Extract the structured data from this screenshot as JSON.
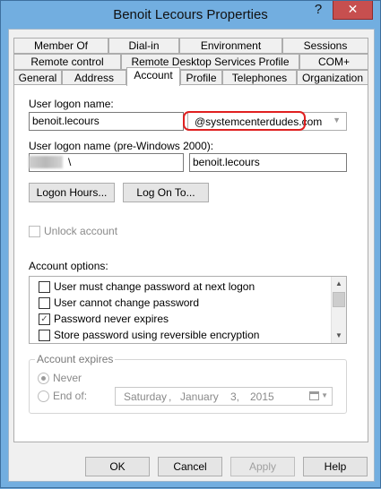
{
  "window": {
    "title": "Benoit Lecours Properties",
    "help_glyph": "?",
    "close_glyph": "✕"
  },
  "tabs": {
    "row1": [
      "Member Of",
      "Dial-in",
      "Environment",
      "Sessions"
    ],
    "row2": [
      "Remote control",
      "Remote Desktop Services Profile",
      "COM+"
    ],
    "row3": [
      "General",
      "Address",
      "Account",
      "Profile",
      "Telephones",
      "Organization"
    ],
    "active": "Account"
  },
  "account": {
    "logon_name_label": "User logon name:",
    "logon_name_value": "benoit.lecours",
    "domain_suffix": "@systemcenterdudes.com",
    "pre2000_label": "User logon name (pre-Windows 2000):",
    "pre2000_domain_suffix": "\\",
    "pre2000_name_value": "benoit.lecours",
    "logon_hours_button": "Logon Hours...",
    "log_on_to_button": "Log On To...",
    "unlock_account_label": "Unlock account",
    "account_options_label": "Account options:",
    "account_options": [
      {
        "label": "User must change password at next logon",
        "checked": false
      },
      {
        "label": "User cannot change password",
        "checked": false
      },
      {
        "label": "Password never expires",
        "checked": true
      },
      {
        "label": "Store password using reversible encryption",
        "checked": false
      }
    ],
    "account_expires": {
      "group_title": "Account expires",
      "never_label": "Never",
      "never_selected": true,
      "end_of_label": "End of:",
      "date": {
        "weekday": "Saturday",
        "sep1": ",",
        "month": "January",
        "day": "3,",
        "year": "2015"
      }
    }
  },
  "footer": {
    "ok": "OK",
    "cancel": "Cancel",
    "apply": "Apply",
    "help": "Help"
  },
  "colors": {
    "highlight_annotation": "#e02020",
    "close_button": "#c74f4f",
    "window_frame": "#72aee0"
  },
  "icons": {
    "check": "✓",
    "arrow_up": "▲",
    "arrow_down": "▼",
    "combo_arrow": "▼"
  }
}
